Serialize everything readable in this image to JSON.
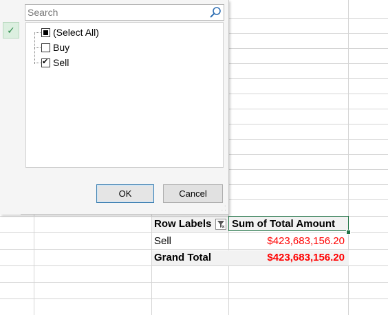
{
  "filter_dialog": {
    "search": {
      "placeholder": "Search",
      "value": ""
    },
    "items": [
      {
        "label": "(Select All)",
        "state": "partial"
      },
      {
        "label": "Buy",
        "state": "unchecked"
      },
      {
        "label": "Sell",
        "state": "checked"
      }
    ],
    "ok_label": "OK",
    "cancel_label": "Cancel"
  },
  "pivot": {
    "row_labels_header": "Row Labels",
    "value_header": "Sum of Total Amount",
    "rows": [
      {
        "label": "Sell",
        "value": "$423,683,156.20"
      }
    ],
    "grand_total_label": "Grand Total",
    "grand_total_value": "$423,683,156.20"
  },
  "colors": {
    "value_text": "#ff0000",
    "selection_border": "#217346",
    "header_bg": "#f2f2f2"
  }
}
